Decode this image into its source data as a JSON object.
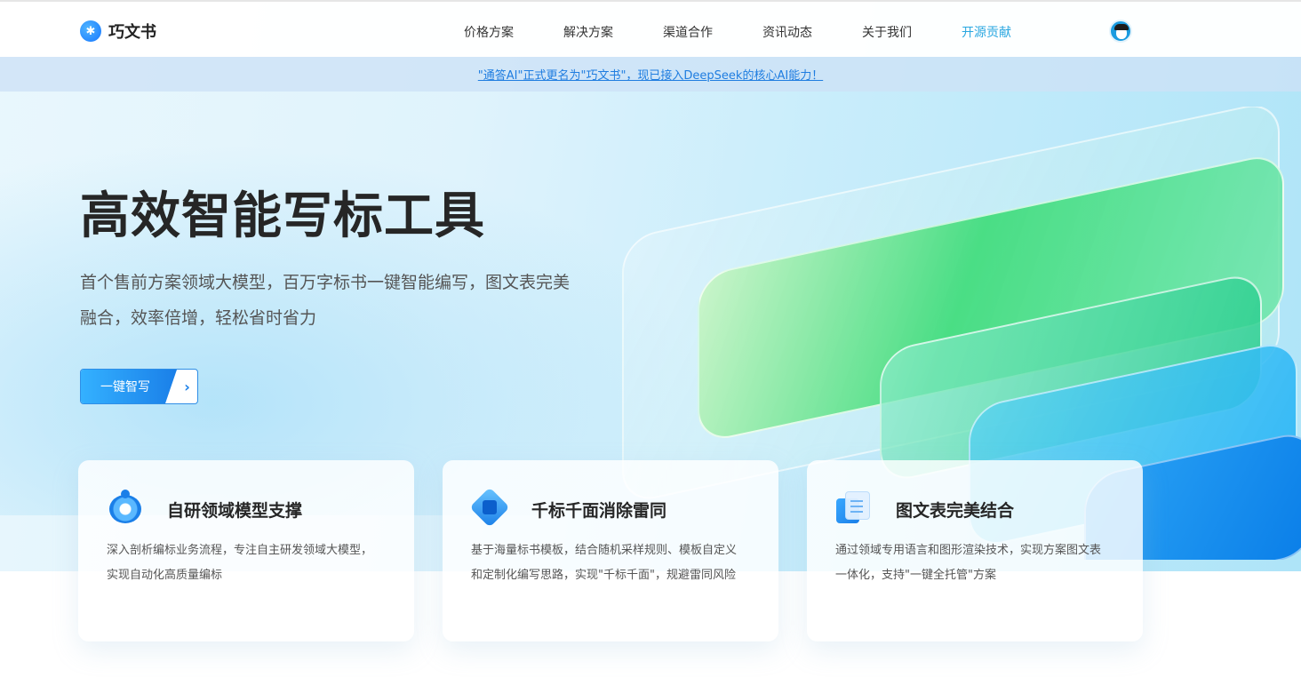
{
  "header": {
    "logo_text": "巧文书",
    "nav": [
      {
        "label": "价格方案"
      },
      {
        "label": "解决方案"
      },
      {
        "label": "渠道合作"
      },
      {
        "label": "资讯动态"
      },
      {
        "label": "关于我们"
      },
      {
        "label": "开源贡献",
        "active": true
      }
    ]
  },
  "notice": {
    "text": "\"通答AI\"正式更名为\"巧文书\"，现已接入DeepSeek的核心AI能力！"
  },
  "hero": {
    "title": "高效智能写标工具",
    "desc": "首个售前方案领域大模型，百万字标书一键智能编写，图文表完美融合，效率倍增，轻松省时省力",
    "cta_label": "一键智写",
    "cta_arrow": "›"
  },
  "features": [
    {
      "title": "自研领域模型支撑",
      "desc": "深入剖析编标业务流程，专注自主研发领域大模型，实现自动化高质量编标",
      "icon": "model-ring-icon"
    },
    {
      "title": "千标千面消除雷同",
      "desc": "基于海量标书模板，结合随机采样规则、模板自定义和定制化编写思路，实现\"千标千面\"，规避雷同风险",
      "icon": "cube-gear-icon"
    },
    {
      "title": "图文表完美结合",
      "desc": "通过领域专用语言和图形渲染技术，实现方案图文表一体化，支持\"一键全托管\"方案",
      "icon": "document-icon"
    }
  ],
  "colors": {
    "accent": "#1a7fe8",
    "nav_active": "#2aa7e0",
    "notice_link": "#1f7de0"
  }
}
